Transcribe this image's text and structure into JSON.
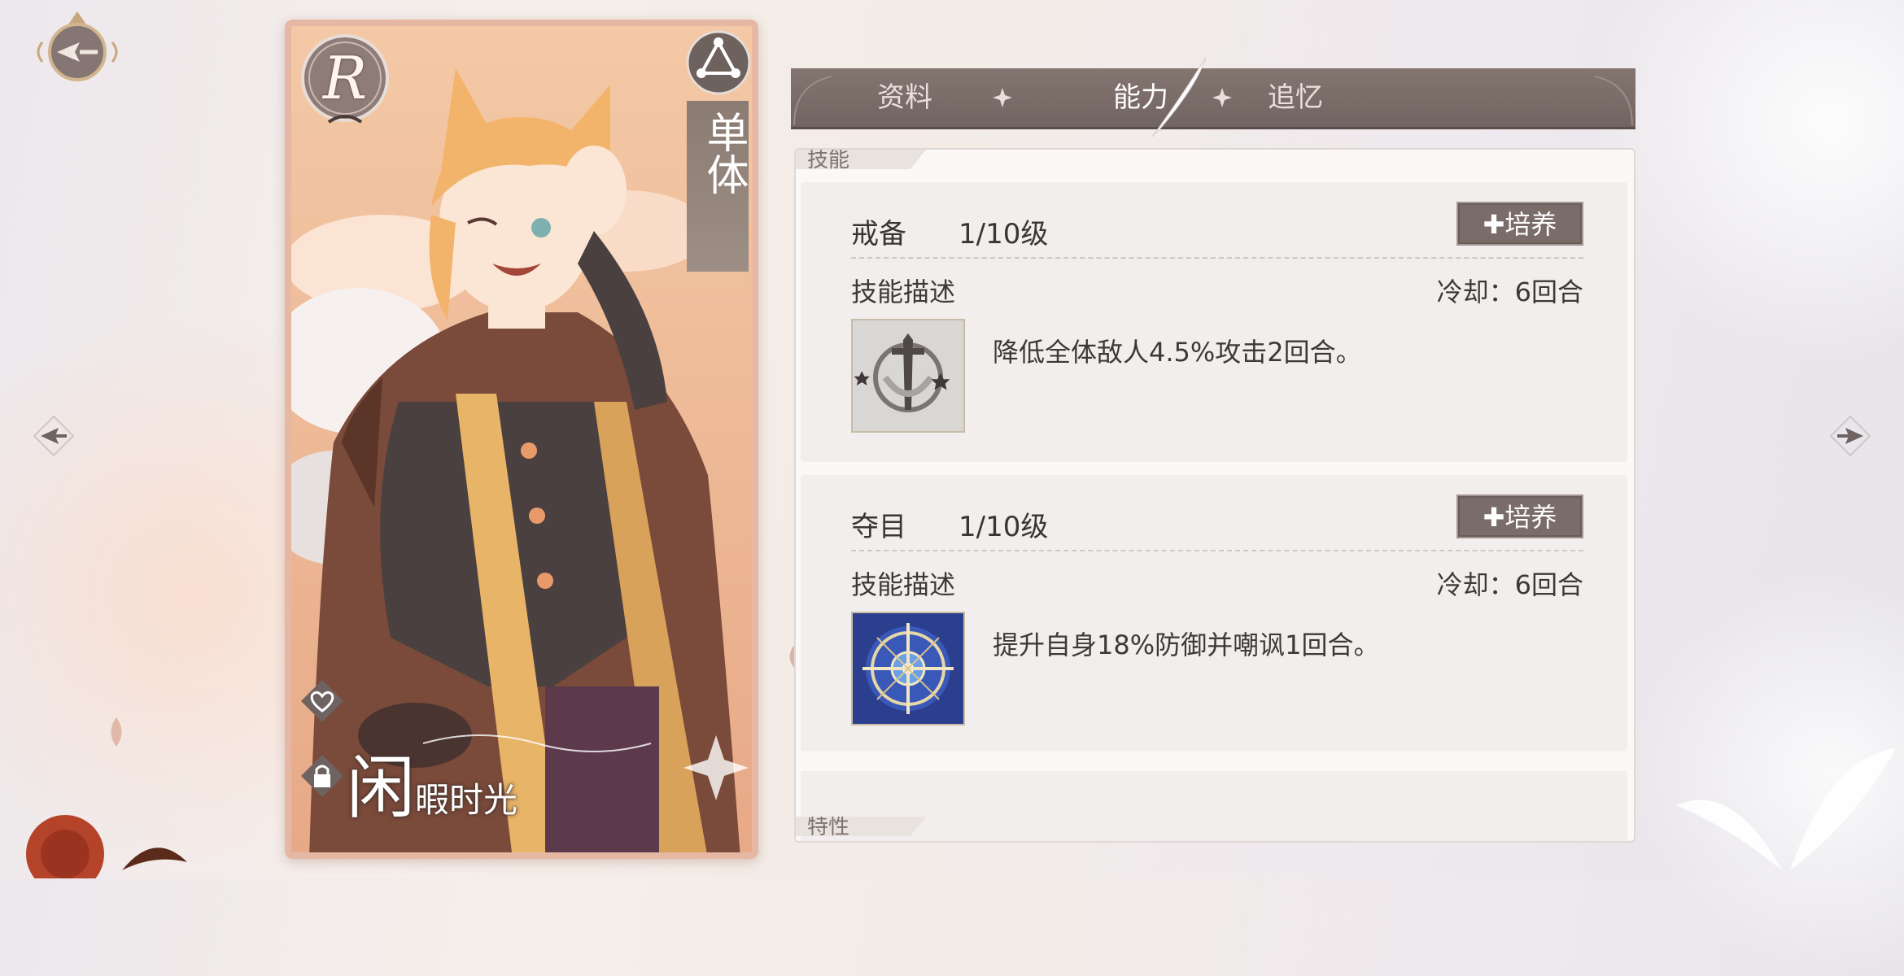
{
  "card": {
    "rarity": "R",
    "target": "单体",
    "title_big": "闲",
    "title_small": "暇时光"
  },
  "tabs": [
    {
      "label": "资料"
    },
    {
      "label": "能力",
      "active": true
    },
    {
      "label": "追忆"
    }
  ],
  "section": {
    "label": "技能",
    "next_label": "特性"
  },
  "skills": [
    {
      "name": "戒备",
      "level": "1/10级",
      "cultivate_label": "培养",
      "desc_label": "技能描述",
      "cooldown": "冷却：6回合",
      "description": "降低全体敌人4.5%攻击2回合。",
      "icon": "sword-shield-icon"
    },
    {
      "name": "夺目",
      "level": "1/10级",
      "cultivate_label": "培养",
      "desc_label": "技能描述",
      "cooldown": "冷却：6回合",
      "description": "提升自身18%防御并嘲讽1回合。",
      "icon": "compass-target-icon"
    }
  ],
  "colors": {
    "tab_bar": "#7a6c68",
    "card_border": "#e6b8a4",
    "panel_bg": "#fbf9f8"
  }
}
